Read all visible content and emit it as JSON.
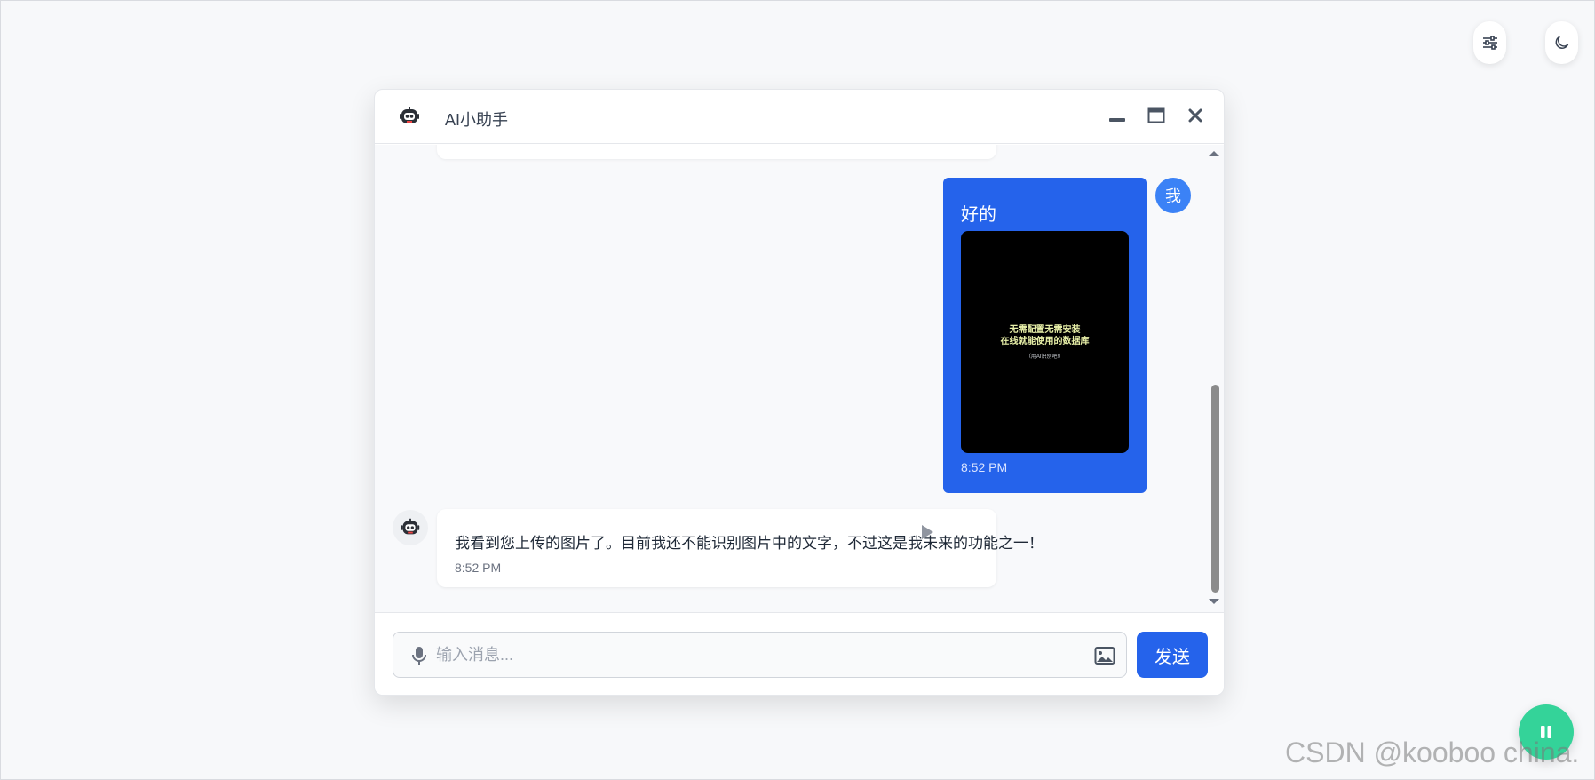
{
  "toolbar": {
    "settings_icon": "sliders-icon",
    "theme_icon": "moon-icon"
  },
  "chat": {
    "title": "AI小助手",
    "header_avatar_icon": "robot-icon",
    "window_controls": [
      "minimize-icon",
      "maximize-icon",
      "close-icon"
    ],
    "messages": [
      {
        "role": "user",
        "avatar_label": "我",
        "text": "好的",
        "image": {
          "line1": "无需配置无需安装",
          "line2": "在线就能使用的数据库",
          "line3": "（用AI识别吧!）"
        },
        "time": "8:52 PM"
      },
      {
        "role": "assistant",
        "avatar_icon": "robot-icon",
        "text": "我看到您上传的图片了。目前我还不能识别图片中的文字，不过这是我未来的功能之一！",
        "time": "8:52 PM"
      }
    ]
  },
  "input": {
    "placeholder": "输入消息...",
    "value": "",
    "send_label": "发送"
  },
  "fab": {
    "icon": "pause-icon"
  },
  "watermark": "CSDN @kooboo china.",
  "colors": {
    "accent": "#2563eb",
    "fab": "#34d399",
    "background": "#f7f8fa"
  }
}
